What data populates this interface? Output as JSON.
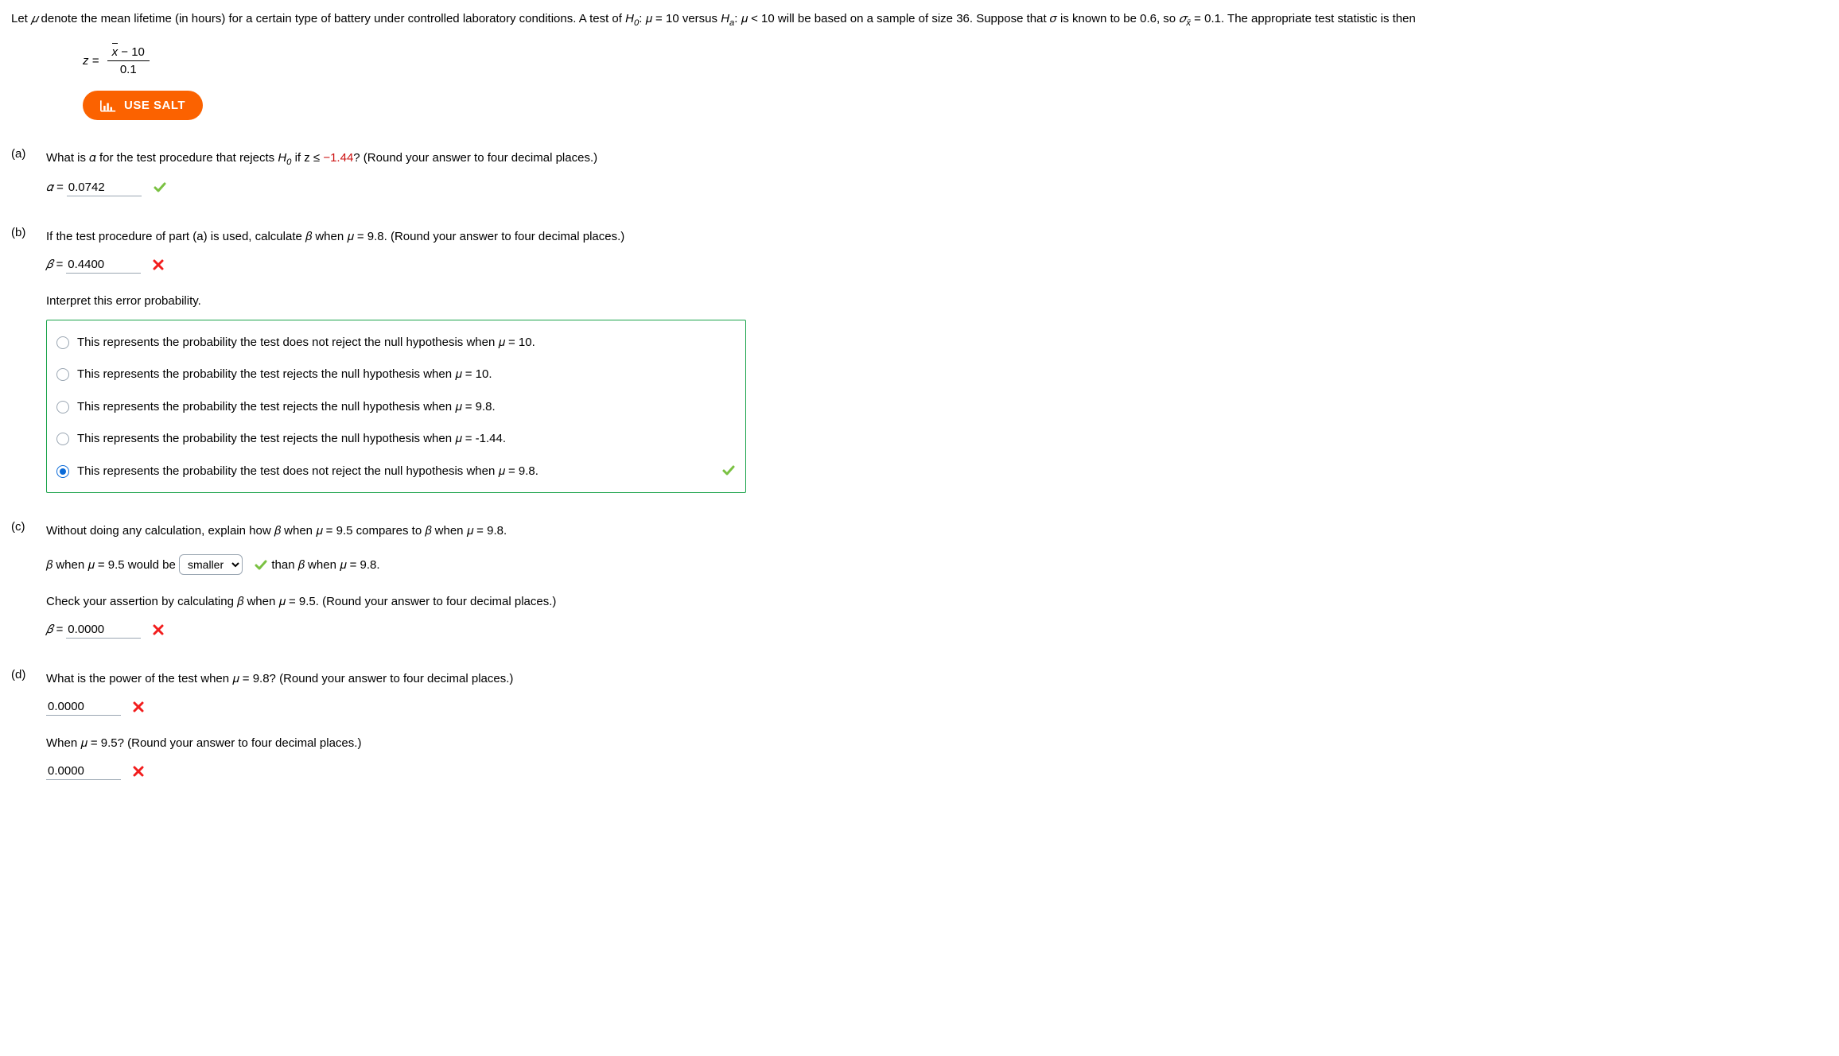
{
  "intro": {
    "p1_a": "Let ",
    "mu": "𝜇",
    "p1_b": " denote the mean lifetime (in hours) for a certain type of battery under controlled laboratory conditions. A test of ",
    "H0": "H",
    "H0sub": "0",
    "colon_mu_eq": ": 𝜇 = 10 versus ",
    "Ha": "H",
    "Hasub": "a",
    "colon_mu_lt": ": 𝜇 < 10 will be based on a sample of size 36. Suppose that 𝜎 is known to be 0.6, so ",
    "sigma_xbar_a": "𝜎",
    "sigma_xbar_b": "x̄",
    "sigma_eq": " = 0.1. The appropriate test statistic is then"
  },
  "formula": {
    "z_eq": "z =",
    "num_a": "x",
    "num_b": " − 10",
    "den": "0.1"
  },
  "salt": {
    "label": "USE SALT"
  },
  "parts": {
    "a": {
      "label": "(a)",
      "q1_a": "What is 𝛼 for the test procedure that rejects ",
      "q1_H0": "H",
      "q1_H0sub": "0",
      "q1_b": " if z ≤ ",
      "q1_neg": "−1.44",
      "q1_c": "? (Round your answer to four decimal places.)",
      "ans_label": "𝛼 =",
      "value": "0.0742",
      "correct": true
    },
    "b": {
      "label": "(b)",
      "q": "If the test procedure of part (a) is used, calculate 𝛽 when 𝜇 = 9.8. (Round your answer to four decimal places.)",
      "ans_label": "𝛽 =",
      "value": "0.4400",
      "correct": false,
      "interpret": "Interpret this error probability.",
      "options": [
        "This represents the probability the test does not reject the null hypothesis when 𝜇 = 10.",
        "This represents the probability the test rejects the null hypothesis when 𝜇 = 10.",
        "This represents the probability the test rejects the null hypothesis when 𝜇 = 9.8.",
        "This represents the probability the test rejects the null hypothesis when 𝜇 = -1.44.",
        "This represents the probability the test does not reject the null hypothesis when 𝜇 = 9.8."
      ],
      "selected": 4,
      "options_correct": true
    },
    "c": {
      "label": "(c)",
      "q": "Without doing any calculation, explain how 𝛽 when 𝜇 = 9.5 compares to 𝛽 when 𝜇 = 9.8.",
      "line_a": "𝛽 when 𝜇 = 9.5 would be ",
      "dropdown": "smaller",
      "line_b": " than 𝛽 when 𝜇 = 9.8.",
      "dropdown_correct": true,
      "check": "Check your assertion by calculating 𝛽 when 𝜇 = 9.5. (Round your answer to four decimal places.)",
      "ans_label": "𝛽 =",
      "value": "0.0000",
      "correct": false
    },
    "d": {
      "label": "(d)",
      "q": "What is the power of the test when 𝜇 = 9.8? (Round your answer to four decimal places.)",
      "value1": "0.0000",
      "correct1": false,
      "q2": "When 𝜇 = 9.5? (Round your answer to four decimal places.)",
      "value2": "0.0000",
      "correct2": false
    }
  }
}
